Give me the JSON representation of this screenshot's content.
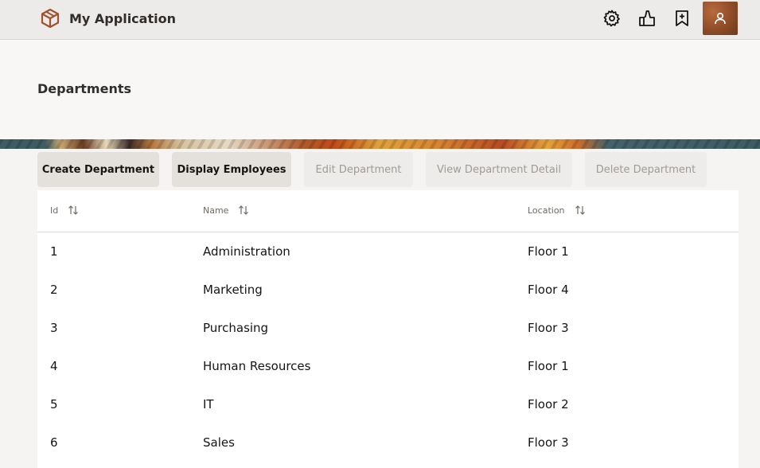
{
  "header": {
    "app_title": "My Application",
    "icons": [
      "box-logo-icon",
      "gear-icon",
      "thumbs-up-icon",
      "bookmark-add-icon",
      "user-icon"
    ]
  },
  "page": {
    "title": "Departments"
  },
  "toolbar": {
    "create": "Create Department",
    "display": "Display Employees",
    "edit": "Edit Department",
    "view": "View Department Detail",
    "delete": "Delete Department"
  },
  "table": {
    "columns": [
      "Id",
      "Name",
      "Location"
    ],
    "rows": [
      {
        "id": "1",
        "name": "Administration",
        "location": "Floor 1"
      },
      {
        "id": "2",
        "name": "Marketing",
        "location": "Floor 4"
      },
      {
        "id": "3",
        "name": "Purchasing",
        "location": "Floor 3"
      },
      {
        "id": "4",
        "name": "Human Resources",
        "location": "Floor 1"
      },
      {
        "id": "5",
        "name": "IT",
        "location": "Floor 2"
      },
      {
        "id": "6",
        "name": "Sales",
        "location": "Floor 3"
      }
    ]
  },
  "colors": {
    "accent": "#a0522d",
    "enabled_button": "#e4e1dd",
    "disabled_button": "#edecea"
  }
}
